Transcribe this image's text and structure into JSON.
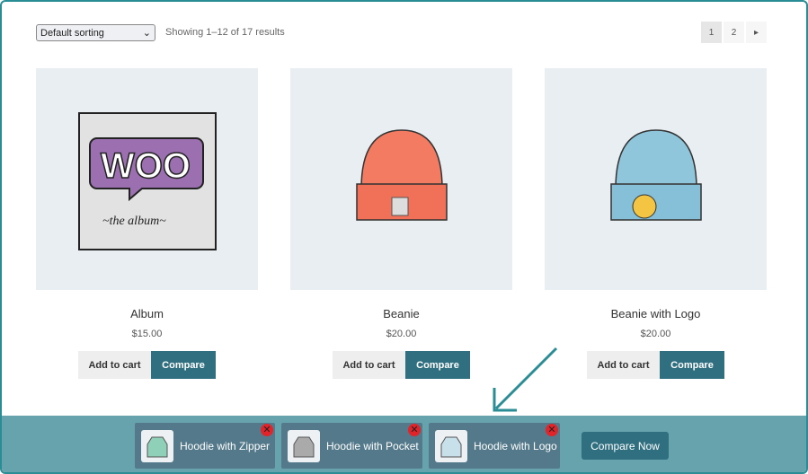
{
  "toolbar": {
    "sort_label": "Default sorting",
    "result_count": "Showing 1–12 of 17 results",
    "pages": [
      "1",
      "2"
    ],
    "current_page": "1"
  },
  "products": [
    {
      "title": "Album",
      "price": "$15.00",
      "add_label": "Add to cart",
      "compare_label": "Compare"
    },
    {
      "title": "Beanie",
      "price": "$20.00",
      "add_label": "Add to cart",
      "compare_label": "Compare"
    },
    {
      "title": "Beanie with Logo",
      "price": "$20.00",
      "add_label": "Add to cart",
      "compare_label": "Compare"
    }
  ],
  "compare_bar": {
    "items": [
      {
        "name": "Hoodie with Zipper"
      },
      {
        "name": "Hoodie with Pocket"
      },
      {
        "name": "Hoodie with Logo"
      }
    ],
    "compare_now_label": "Compare Now"
  },
  "colors": {
    "accent": "#2f6f80",
    "bar": "#67a3ac",
    "item": "#53798a",
    "frame": "#2a8d95"
  }
}
